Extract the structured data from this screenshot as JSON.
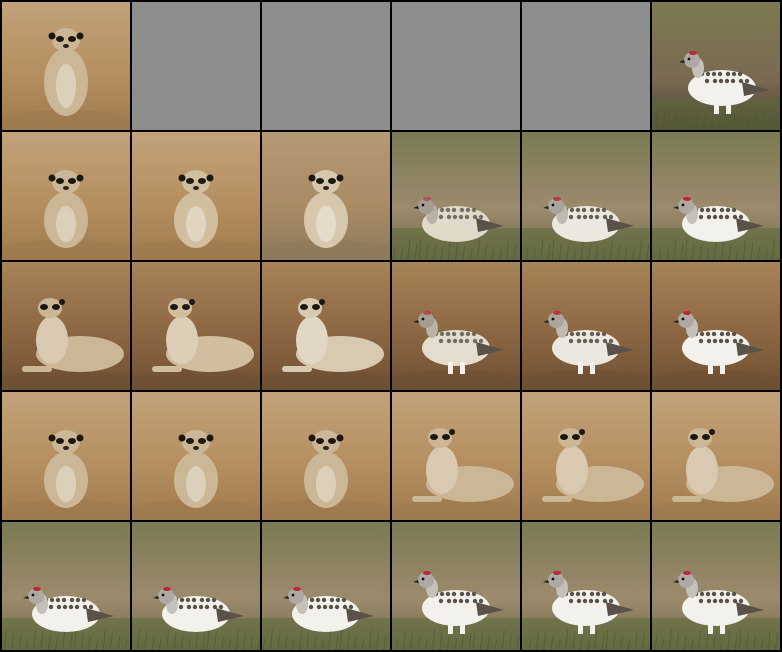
{
  "grid": {
    "columns": 6,
    "rows": 5,
    "colors": {
      "border": "#000000",
      "empty_tile": "#8e8e8e",
      "meerkat_fur": "#cbb795",
      "meerkat_eye_patch": "#1b1713",
      "ptarmigan_white": "#f2f1ec",
      "ptarmigan_mottle": "#5a5248",
      "comb_red": "#c0253a"
    },
    "cells": [
      {
        "subject": "meerkat",
        "pose": "standing",
        "bg": "sand",
        "morph": 0
      },
      {
        "subject": "empty"
      },
      {
        "subject": "empty"
      },
      {
        "subject": "empty"
      },
      {
        "subject": "empty"
      },
      {
        "subject": "ptarmigan",
        "pose": "standing-right",
        "bg": "rock",
        "morph": 1
      },
      {
        "subject": "meerkat",
        "pose": "sitting",
        "bg": "sand",
        "morph": 0
      },
      {
        "subject": "meerkat",
        "pose": "sitting",
        "bg": "sand",
        "morph": 0.15
      },
      {
        "subject": "meerkat",
        "pose": "sitting",
        "bg": "mix",
        "morph": 0.35
      },
      {
        "subject": "blend",
        "pose": "crouch-right",
        "bg": "grass",
        "morph": 0.6
      },
      {
        "subject": "ptarmigan",
        "pose": "crouch-right",
        "bg": "grass",
        "morph": 0.85
      },
      {
        "subject": "ptarmigan",
        "pose": "crouch-right",
        "bg": "grass",
        "morph": 1
      },
      {
        "subject": "meerkat",
        "pose": "lying",
        "bg": "brown",
        "morph": 0
      },
      {
        "subject": "meerkat",
        "pose": "lying",
        "bg": "brown",
        "morph": 0.15
      },
      {
        "subject": "blend",
        "pose": "lying",
        "bg": "brown",
        "morph": 0.4
      },
      {
        "subject": "blend",
        "pose": "walk-right",
        "bg": "brown",
        "morph": 0.65
      },
      {
        "subject": "ptarmigan",
        "pose": "walk-right",
        "bg": "brown",
        "morph": 0.85
      },
      {
        "subject": "ptarmigan",
        "pose": "walk-right",
        "bg": "brown",
        "morph": 1
      },
      {
        "subject": "meerkat",
        "pose": "sitting",
        "bg": "sand",
        "morph": 0
      },
      {
        "subject": "meerkat",
        "pose": "sitting",
        "bg": "sand",
        "morph": 0
      },
      {
        "subject": "meerkat",
        "pose": "sitting",
        "bg": "sand",
        "morph": 0
      },
      {
        "subject": "meerkat",
        "pose": "lying",
        "bg": "sand",
        "morph": 0
      },
      {
        "subject": "meerkat",
        "pose": "lying",
        "bg": "sand",
        "morph": 0
      },
      {
        "subject": "meerkat",
        "pose": "lying",
        "bg": "sand",
        "morph": 0
      },
      {
        "subject": "ptarmigan",
        "pose": "crouch-right",
        "bg": "grass",
        "morph": 1
      },
      {
        "subject": "ptarmigan",
        "pose": "crouch-right",
        "bg": "grass",
        "morph": 1
      },
      {
        "subject": "ptarmigan",
        "pose": "crouch-right",
        "bg": "grass",
        "morph": 1
      },
      {
        "subject": "ptarmigan",
        "pose": "walk-right",
        "bg": "grass",
        "morph": 1
      },
      {
        "subject": "ptarmigan",
        "pose": "walk-right",
        "bg": "grass",
        "morph": 1
      },
      {
        "subject": "ptarmigan",
        "pose": "walk-right",
        "bg": "grass",
        "morph": 1
      }
    ]
  }
}
